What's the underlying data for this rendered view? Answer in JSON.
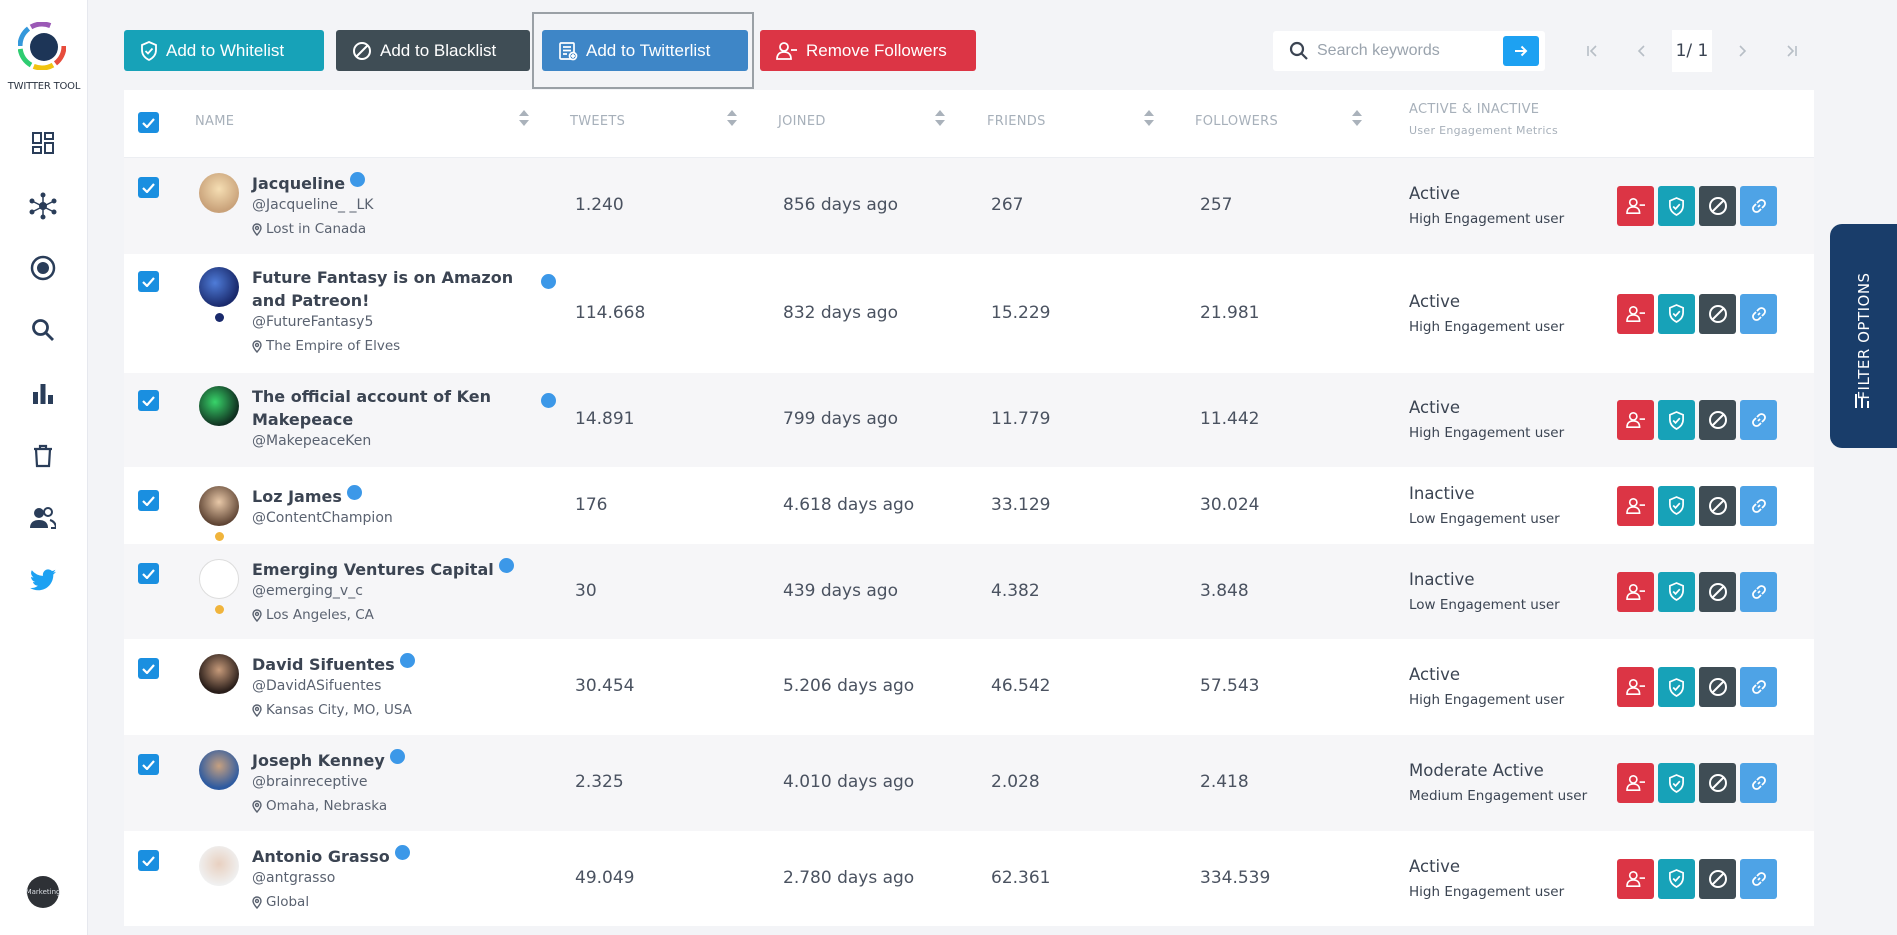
{
  "app": {
    "logo_text": "TWITTER TOOL",
    "user_avatar_text": "Marketing"
  },
  "sidebar": {
    "icons": [
      "dashboard-icon",
      "network-icon",
      "target-icon",
      "search-icon",
      "chart-icon",
      "trash-icon",
      "users-icon",
      "twitter-icon"
    ]
  },
  "toolbar": {
    "whitelist_label": "Add to Whitelist",
    "blacklist_label": "Add to Blacklist",
    "twitterlist_label": "Add to Twitterlist",
    "remove_label": "Remove Followers"
  },
  "search": {
    "placeholder": "Search keywords"
  },
  "pagination": {
    "current": "1/ 1"
  },
  "table": {
    "headers": {
      "name": "NAME",
      "tweets": "TWEETS",
      "joined": "JOINED",
      "friends": "FRIENDS",
      "followers": "FOLLOWERS",
      "activity": "ACTIVE & INACTIVE",
      "activity_sub": "User Engagement Metrics"
    },
    "rows": [
      {
        "name": "Jacqueline",
        "handle": "@Jacqueline_ _LK",
        "location": "Lost in Canada",
        "tweets": "1.240",
        "joined": "856 days ago",
        "friends": "267",
        "followers": "257",
        "status": "Active",
        "engagement": "High Engagement user"
      },
      {
        "name": "Future Fantasy is on Amazon and Patreon!",
        "handle": "@FutureFantasy5",
        "location": "The Empire of Elves",
        "tweets": "114.668",
        "joined": "832 days ago",
        "friends": "15.229",
        "followers": "21.981",
        "status": "Active",
        "engagement": "High Engagement user"
      },
      {
        "name": "The official account of Ken Makepeace",
        "handle": "@MakepeaceKen",
        "location": "",
        "tweets": "14.891",
        "joined": "799 days ago",
        "friends": "11.779",
        "followers": "11.442",
        "status": "Active",
        "engagement": "High Engagement user"
      },
      {
        "name": "Loz James",
        "handle": "@ContentChampion",
        "location": "",
        "tweets": "176",
        "joined": "4.618 days ago",
        "friends": "33.129",
        "followers": "30.024",
        "status": "Inactive",
        "engagement": "Low Engagement user"
      },
      {
        "name": "Emerging Ventures Capital",
        "handle": "@emerging_v_c",
        "location": "Los Angeles, CA",
        "tweets": "30",
        "joined": "439 days ago",
        "friends": "4.382",
        "followers": "3.848",
        "status": "Inactive",
        "engagement": "Low Engagement user"
      },
      {
        "name": "David Sifuentes",
        "handle": "@DavidASifuentes",
        "location": "Kansas City, MO, USA",
        "tweets": "30.454",
        "joined": "5.206 days ago",
        "friends": "46.542",
        "followers": "57.543",
        "status": "Active",
        "engagement": "High Engagement user"
      },
      {
        "name": "Joseph Kenney",
        "handle": "@brainreceptive",
        "location": "Omaha, Nebraska",
        "tweets": "2.325",
        "joined": "4.010 days ago",
        "friends": "2.028",
        "followers": "2.418",
        "status": "Moderate Active",
        "engagement": "Medium Engagement user"
      },
      {
        "name": "Antonio Grasso",
        "handle": "@antgrasso",
        "location": "Global",
        "tweets": "49.049",
        "joined": "2.780 days ago",
        "friends": "62.361",
        "followers": "334.539",
        "status": "Active",
        "engagement": "High Engagement user"
      }
    ]
  },
  "filter": {
    "label": "FILTER OPTIONS"
  },
  "colors": {
    "accent": "#1da1f2",
    "danger": "#dc3545",
    "teal": "#17a2b8",
    "dark": "#3f4d55",
    "navy": "#193d6a"
  }
}
